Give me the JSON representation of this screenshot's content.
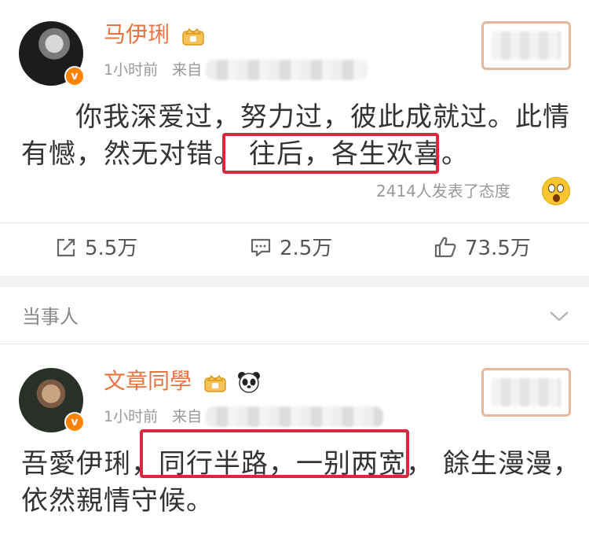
{
  "post1": {
    "username": "马伊琍",
    "time": "1小时前",
    "source_prefix": "来自",
    "text_line1": "你我深爱过，努力过，彼此成就过。此情",
    "text_line2_a": "有憾，然无对错。",
    "text_line2_b": "往后，各生欢喜。",
    "attitude_count": "2414人发表了态度"
  },
  "actions": {
    "repost": "5.5万",
    "comment": "2.5万",
    "like": "73.5万"
  },
  "section": {
    "label": "当事人"
  },
  "post2": {
    "username": "文章同學",
    "time": "1小时前",
    "source_prefix": "来自",
    "text_line1_a": "吾愛伊琍，",
    "text_line1_b": "同行半路，一别两宽，",
    "text_line1_c": "餘生漫漫，",
    "text_line2": "依然親情守候。"
  },
  "colors": {
    "username": "#eb7340",
    "highlight_box": "#d8283f",
    "verified_badge": "#ff8200"
  }
}
